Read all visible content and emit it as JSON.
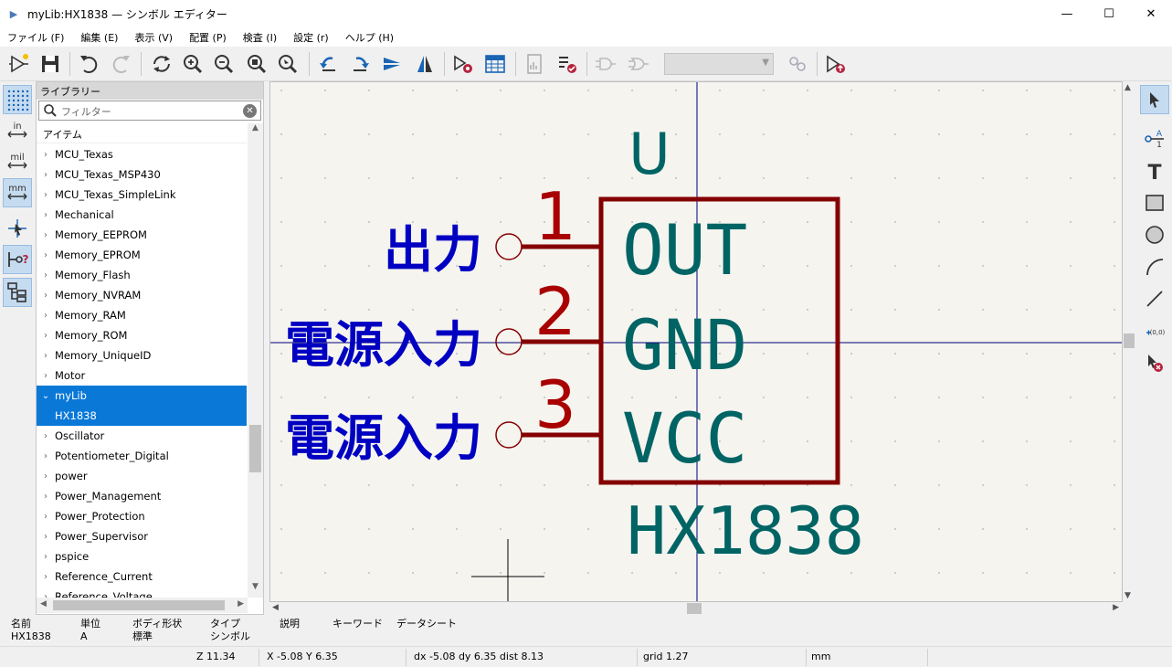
{
  "window": {
    "title": "myLib:HX1838 — シンボル エディター",
    "minimize": "—",
    "maximize": "☐",
    "close": "✕"
  },
  "menu": [
    "ファイル (F)",
    "編集 (E)",
    "表示 (V)",
    "配置 (P)",
    "検査 (I)",
    "設定 (r)",
    "ヘルプ (H)"
  ],
  "toolbar": {
    "icons": [
      "new-symbol-icon",
      "save-icon",
      "undo-icon",
      "redo-icon",
      "refresh-icon",
      "zoom-in-icon",
      "zoom-out-icon",
      "zoom-fit-icon",
      "zoom-selection-icon",
      "rotate-ccw-icon",
      "rotate-cw-icon",
      "mirror-vertical-icon",
      "mirror-horizontal-icon",
      "symbol-properties-icon",
      "pin-table-icon",
      "datasheet-icon",
      "symbol-checker-icon",
      "de-morgan-standard-icon",
      "de-morgan-alternate-icon",
      "unit-select",
      "sync-pins-icon",
      "add-symbol-to-schematic-icon"
    ],
    "unit_select_value": ""
  },
  "left_toolbar": [
    "grid-toggle-icon",
    "inches-icon",
    "mils-icon",
    "millimeters-icon",
    "cursor-crosshair-icon",
    "hidden-pins-icon",
    "library-tree-icon"
  ],
  "left_labels": {
    "in": "in",
    "mil": "mil",
    "mm": "mm"
  },
  "library": {
    "header": "ライブラリー",
    "filter_placeholder": "フィルター",
    "column": "アイテム",
    "items": [
      {
        "label": "MCU_Texas",
        "state": "collapsed"
      },
      {
        "label": "MCU_Texas_MSP430",
        "state": "collapsed"
      },
      {
        "label": "MCU_Texas_SimpleLink",
        "state": "collapsed"
      },
      {
        "label": "Mechanical",
        "state": "collapsed"
      },
      {
        "label": "Memory_EEPROM",
        "state": "collapsed"
      },
      {
        "label": "Memory_EPROM",
        "state": "collapsed"
      },
      {
        "label": "Memory_Flash",
        "state": "collapsed"
      },
      {
        "label": "Memory_NVRAM",
        "state": "collapsed"
      },
      {
        "label": "Memory_RAM",
        "state": "collapsed"
      },
      {
        "label": "Memory_ROM",
        "state": "collapsed"
      },
      {
        "label": "Memory_UniqueID",
        "state": "collapsed"
      },
      {
        "label": "Motor",
        "state": "collapsed"
      },
      {
        "label": "myLib",
        "state": "expanded",
        "selected": true
      },
      {
        "label": "HX1838",
        "state": "child",
        "selected": true
      },
      {
        "label": "Oscillator",
        "state": "collapsed"
      },
      {
        "label": "Potentiometer_Digital",
        "state": "collapsed"
      },
      {
        "label": "power",
        "state": "collapsed"
      },
      {
        "label": "Power_Management",
        "state": "collapsed"
      },
      {
        "label": "Power_Protection",
        "state": "collapsed"
      },
      {
        "label": "Power_Supervisor",
        "state": "collapsed"
      },
      {
        "label": "pspice",
        "state": "collapsed"
      },
      {
        "label": "Reference_Current",
        "state": "collapsed"
      },
      {
        "label": "Reference_Voltage",
        "state": "collapsed"
      }
    ]
  },
  "symbol": {
    "reference": "U",
    "value": "HX1838",
    "pins": [
      {
        "number": "1",
        "name": "OUT",
        "type_label": "出力"
      },
      {
        "number": "2",
        "name": "GND",
        "type_label": "電源入力"
      },
      {
        "number": "3",
        "name": "VCC",
        "type_label": "電源入力"
      }
    ],
    "colors": {
      "body": "#840000",
      "pin_number": "#a90000",
      "pin_name": "#006464",
      "pin_type": "#0000c2",
      "background": "#f5f4ef",
      "axis": "#00007a"
    }
  },
  "right_toolbar": [
    "select-arrow-icon",
    "add-pin-icon",
    "add-text-icon",
    "add-rectangle-icon",
    "add-circle-icon",
    "add-arc-icon",
    "add-line-icon",
    "anchor-icon",
    "delete-icon"
  ],
  "right_labels": {
    "text_tool": "T",
    "pin_a": "A",
    "pin_1": "1",
    "anchor": "(0,0)"
  },
  "info": {
    "headers": [
      "名前",
      "単位",
      "ボディ形状",
      "タイプ",
      "説明",
      "キーワード",
      "データシート"
    ],
    "values": [
      "HX1838",
      "A",
      "標準",
      "シンボル",
      "",
      "",
      ""
    ]
  },
  "status": {
    "zoom": "Z 11.34",
    "xy": "X -5.08  Y 6.35",
    "dxdy": "dx -5.08  dy 6.35  dist 8.13",
    "grid": "grid 1.27",
    "units": "mm"
  }
}
